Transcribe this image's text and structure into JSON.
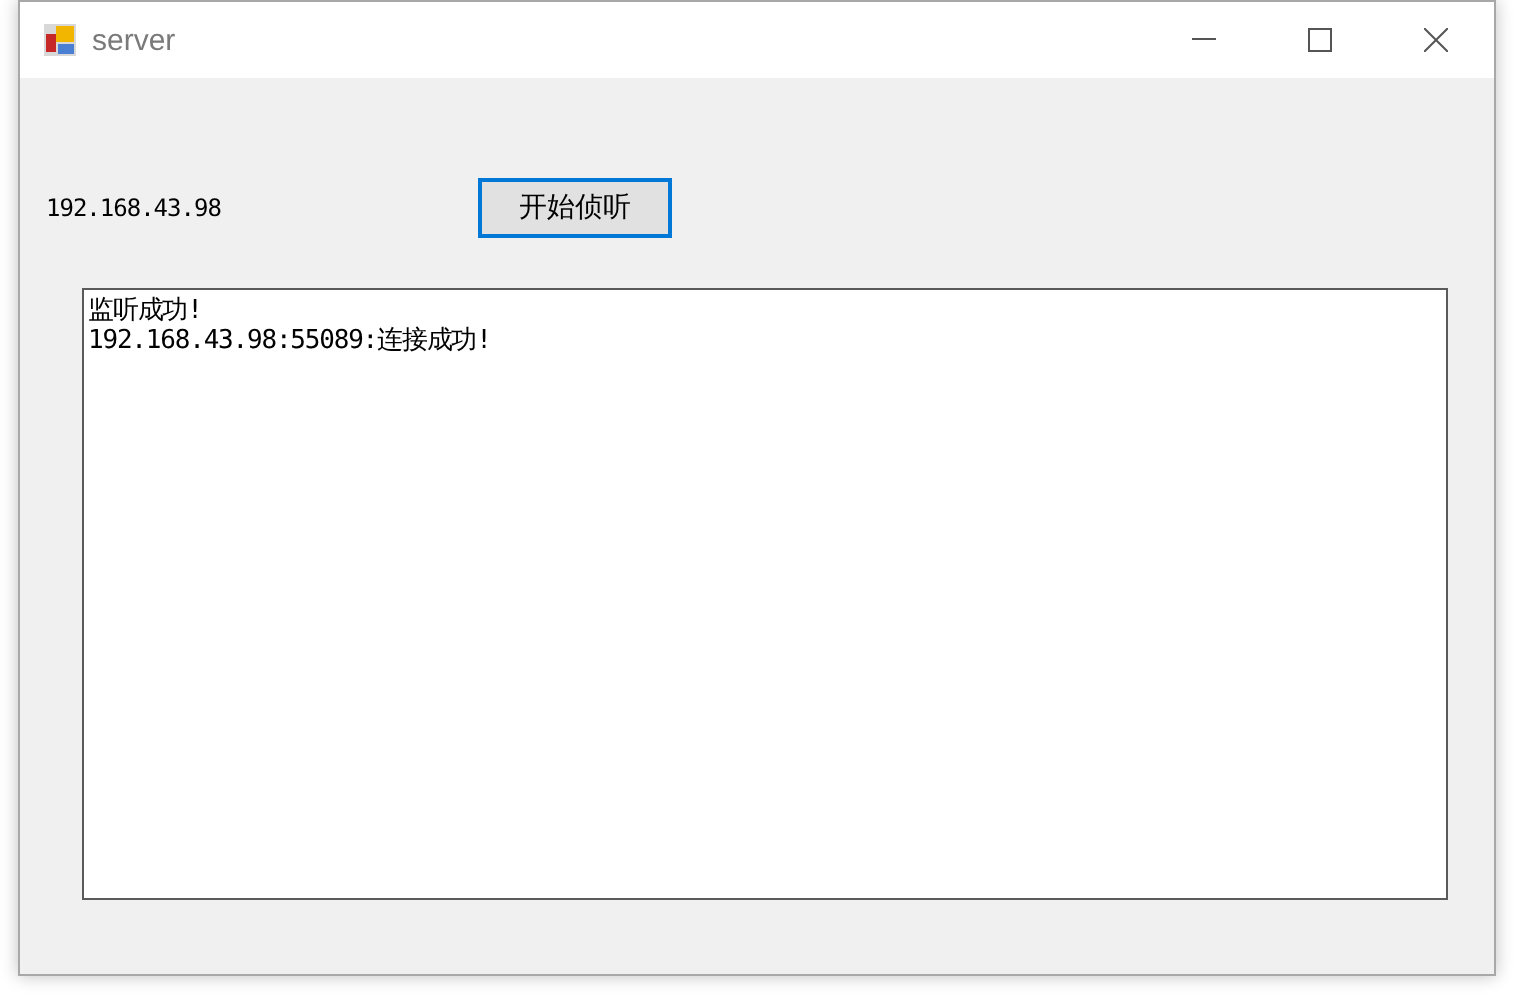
{
  "window": {
    "title": "server"
  },
  "ip_label": "192.168.43.98",
  "start_button": {
    "label": "开始侦听",
    "focused": true
  },
  "log_box": {
    "lines": [
      "监听成功!",
      "192.168.43.98:55089:连接成功!"
    ]
  }
}
